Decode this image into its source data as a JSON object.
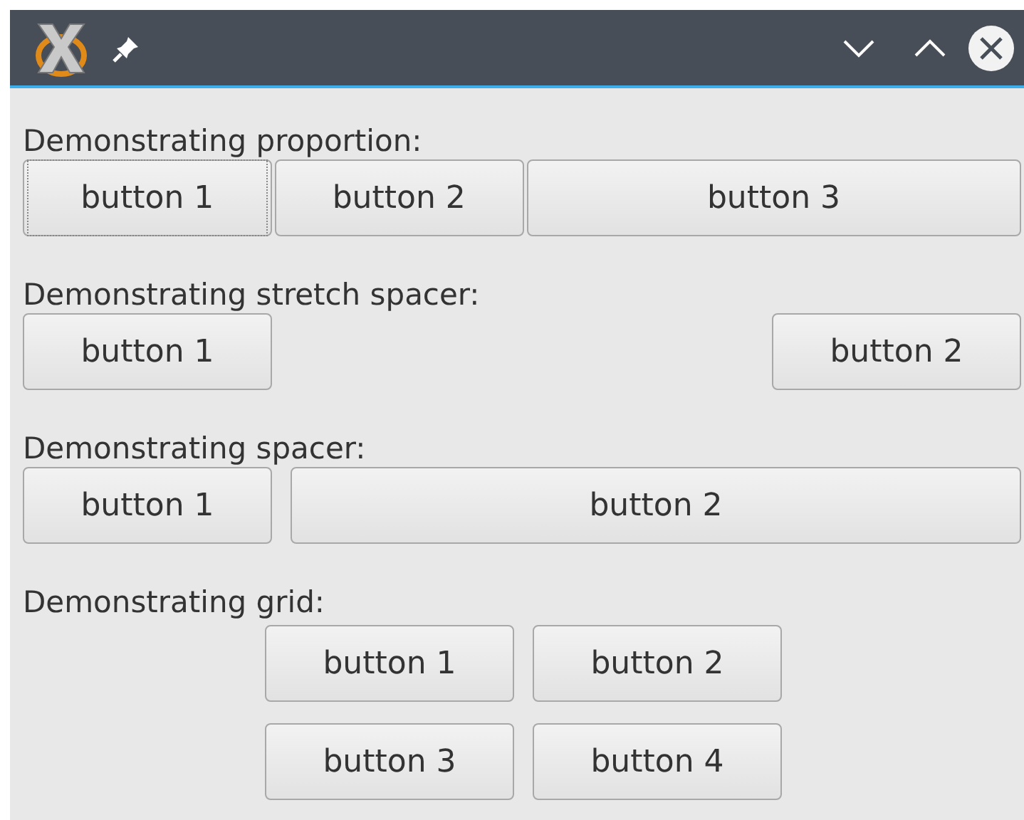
{
  "sections": [
    {
      "kind": "proportion",
      "label": "Demonstrating proportion:",
      "buttons": [
        {
          "label": "button 1",
          "focused": true
        },
        {
          "label": "button 2",
          "focused": false
        },
        {
          "label": "button 3",
          "focused": false
        }
      ]
    },
    {
      "kind": "stretch",
      "label": "Demonstrating stretch spacer:",
      "buttons": [
        {
          "label": "button 1",
          "focused": false
        },
        {
          "label": "button 2",
          "focused": false
        }
      ]
    },
    {
      "kind": "spacer",
      "label": "Demonstrating spacer:",
      "buttons": [
        {
          "label": "button 1",
          "focused": false
        },
        {
          "label": "button 2",
          "focused": false
        }
      ]
    },
    {
      "kind": "grid",
      "label": "Demonstrating grid:",
      "buttons": [
        {
          "label": "button 1",
          "focused": false
        },
        {
          "label": "button 2",
          "focused": false
        },
        {
          "label": "button 3",
          "focused": false
        },
        {
          "label": "button 4",
          "focused": false
        }
      ]
    }
  ]
}
